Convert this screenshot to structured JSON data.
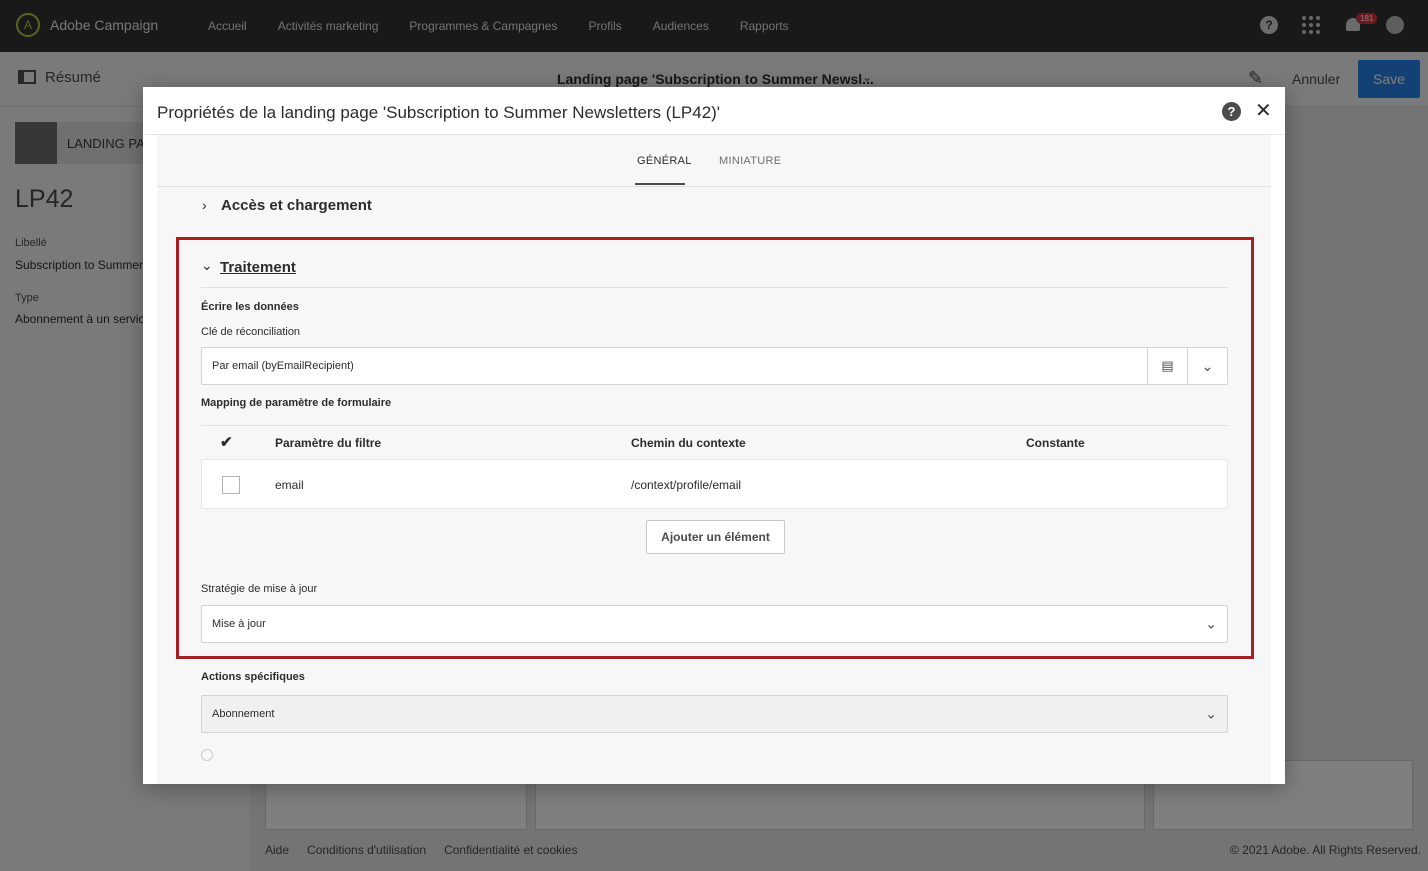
{
  "app": {
    "brand": "Adobe Campaign",
    "nav": [
      "Accueil",
      "Activités marketing",
      "Programmes & Campagnes",
      "Profils",
      "Audiences",
      "Rapports"
    ],
    "notifications_count": "181",
    "help_glyph": "?"
  },
  "subheader": {
    "summary_label": "Résumé",
    "title": "Landing page 'Subscription to Summer Newsl...",
    "cancel_label": "Annuler",
    "save_label": "Save"
  },
  "left_panel": {
    "badge_label": "LANDING PA",
    "code": "LP42",
    "label_caption": "Libellé",
    "label_value": "Subscription to Summer",
    "type_caption": "Type",
    "type_value": "Abonnement à un service"
  },
  "footer": {
    "links": [
      "Aide",
      "Conditions d'utilisation",
      "Confidentialité et cookies"
    ],
    "copyright": "© 2021 Adobe. All Rights Reserved."
  },
  "modal": {
    "title": "Propriétés de la landing page 'Subscription to Summer Newsletters (LP42)'",
    "help_glyph": "?",
    "close_glyph": "✕",
    "tabs": [
      "GÉNÉRAL",
      "MINIATURE"
    ],
    "active_tab": "GÉNÉRAL",
    "section_access": "Accès et chargement",
    "section_processing": "Traitement",
    "write_data_label": "Écrire les données",
    "recon_key_label": "Clé de réconciliation",
    "recon_key_value": "Par email (byEmailRecipient)",
    "mapping_label": "Mapping de paramètre de formulaire",
    "table": {
      "columns": [
        "Paramètre du filtre",
        "Chemin du contexte",
        "Constante"
      ],
      "rows": [
        {
          "param": "email",
          "path": "/context/profile/email",
          "constant": ""
        }
      ]
    },
    "add_element_label": "Ajouter un élément",
    "update_strategy_label": "Stratégie de mise à jour",
    "update_strategy_value": "Mise à jour",
    "specific_actions_label": "Actions spécifiques",
    "specific_actions_value": "Abonnement"
  },
  "colors": {
    "highlight": "#a52022",
    "primary_button": "#2680eb",
    "topbar": "#323232"
  }
}
